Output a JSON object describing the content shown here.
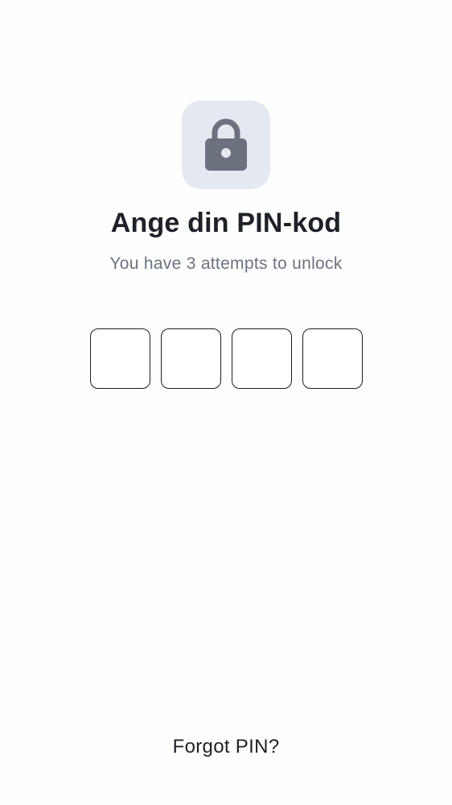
{
  "lock": {
    "icon": "lock-icon",
    "tile_color": "#e3e8f1",
    "icon_color": "#6b727d"
  },
  "title": "Ange din PIN-kod",
  "subtitle": "You have 3 attempts to unlock",
  "pin": {
    "digits": [
      "",
      "",
      "",
      ""
    ]
  },
  "forgot_label": "Forgot PIN?",
  "colors": {
    "background": "#fefefe",
    "text_primary": "#1e2127",
    "text_secondary": "#6a7280",
    "pin_border": "#1b1d22"
  }
}
